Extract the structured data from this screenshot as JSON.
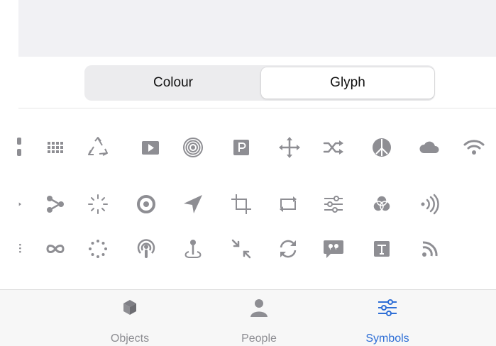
{
  "segmented": {
    "left_label": "Colour",
    "right_label": "Glyph",
    "selected": "Glyph"
  },
  "glyph_rows": [
    [
      "partial-icon",
      "grid-dots-icon",
      "recycle-icon",
      "play-rectangle-icon",
      "target-rings-icon",
      "parking-icon",
      "move-arrows-icon",
      "shuffle-icon",
      "peace-icon",
      "cloud-icon",
      "wifi-icon"
    ],
    [
      "partial-icon",
      "nodes-icon",
      "loading-spinner-icon",
      "record-circle-icon",
      "location-arrow-icon",
      "crop-icon",
      "repeat-arrows-icon",
      "sliders-icon",
      "color-circles-icon",
      "sound-waves-icon"
    ],
    [
      "partial-icon",
      "infinity-icon",
      "dotted-circle-icon",
      "podcast-icon",
      "pin-icon",
      "collapse-arrows-icon",
      "sync-icon",
      "quote-bubble-icon",
      "text-icon",
      "rss-icon"
    ]
  ],
  "tabbar": {
    "tabs": [
      {
        "label": "Objects",
        "icon": "cube-icon",
        "active": false
      },
      {
        "label": "People",
        "icon": "person-icon",
        "active": false
      },
      {
        "label": "Symbols",
        "icon": "sliders-icon",
        "active": true
      }
    ]
  },
  "colors": {
    "glyph": "#8e8e93",
    "accent": "#2f6fd6"
  }
}
